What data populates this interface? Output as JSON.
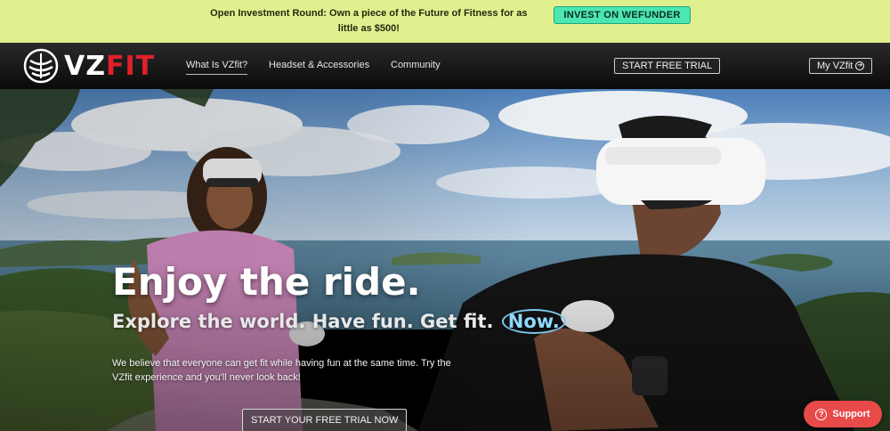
{
  "announcement": {
    "text": "Open Investment Round: Own a piece of the Future of Fitness for as little as $500!",
    "button": "INVEST ON WEFUNDER"
  },
  "nav": {
    "logo_vz": "VZ",
    "logo_fit": "FIT",
    "links": [
      "What Is VZfit?",
      "Headset & Accessories",
      "Community"
    ],
    "trial_button": "START FREE TRIAL",
    "account_button": "My VZfit"
  },
  "hero": {
    "title": "Enjoy the ride.",
    "subtitle": "Explore the world. Have fun. Get fit.",
    "subtitle_highlight": "Now.",
    "body": "We believe that everyone can get fit while having fun at the same time. Try the VZfit experience and you'll never look back!",
    "cta": "START YOUR FREE TRIAL NOW"
  },
  "support": {
    "label": "Support"
  },
  "colors": {
    "announcement_bg": "#e1f08e",
    "invest_button": "#4ce6b0",
    "brand_red": "#e0202a",
    "support_button": "#e84a4a",
    "highlight": "#8fd8ff"
  },
  "icons": [
    "vzfit-logo-icon",
    "arrow-circle-right-icon",
    "question-circle-icon"
  ]
}
